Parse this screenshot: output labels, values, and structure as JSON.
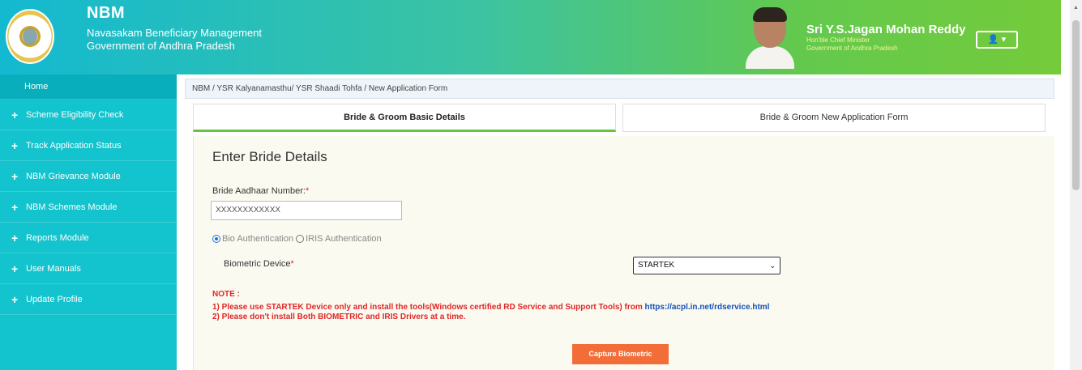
{
  "header": {
    "title": "NBM",
    "subtitle": "Navasakam Beneficiary Management",
    "government": "Government of Andhra Pradesh",
    "cm_name": "Sri Y.S.Jagan Mohan Reddy",
    "cm_title": "Hon'ble Chief Minister",
    "cm_government": "Government of Andhra Pradesh",
    "user_menu": "👤 ▾"
  },
  "sidebar": {
    "items": [
      {
        "label": "Home"
      },
      {
        "label": "Scheme Eligibility Check"
      },
      {
        "label": "Track Application Status"
      },
      {
        "label": "NBM Grievance Module"
      },
      {
        "label": "NBM Schemes Module"
      },
      {
        "label": "Reports Module"
      },
      {
        "label": "User Manuals"
      },
      {
        "label": "Update Profile"
      }
    ]
  },
  "breadcrumb": "NBM / YSR Kalyanamasthu/ YSR Shaadi Tohfa / New Application Form",
  "tabs": [
    {
      "label": "Bride & Groom Basic Details",
      "active": true
    },
    {
      "label": "Bride & Groom New Application Form",
      "active": false
    }
  ],
  "form": {
    "title": "Enter Bride Details",
    "aadhaar_label": "Bride Aadhaar Number:",
    "required_mark": "*",
    "aadhaar_value": "XXXXXXXXXXXX",
    "auth_options": [
      "Bio Authentication",
      "IRIS Authentication"
    ],
    "selected_auth": "Bio Authentication",
    "biometric_label": "Biometric Device",
    "device_value": "STARTEK"
  },
  "note": {
    "title": "NOTE :",
    "line1": "1) Please use STARTEK Device only and install the tools(Windows certified RD Service and Support Tools) from ",
    "link": "https://acpl.in.net/rdservice.html",
    "line2": "2) Please don't install Both BIOMETRIC and IRIS Drivers at a time."
  },
  "actions": {
    "capture": "Capture Biometric"
  },
  "colors": {
    "sidebar": "#13c3cd",
    "header_start": "#13b9d1",
    "header_end": "#75cb3a",
    "active_tab": "#69c33b",
    "note": "#e12626",
    "button": "#f36d38"
  }
}
